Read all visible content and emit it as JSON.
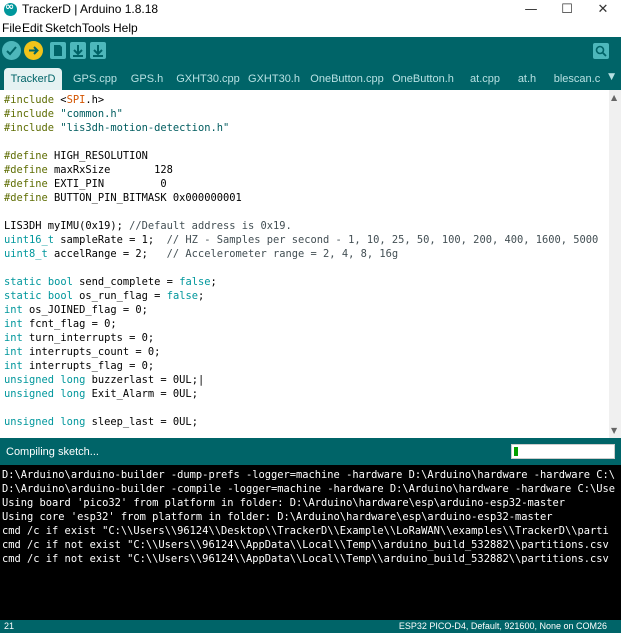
{
  "window": {
    "title": "TrackerD | Arduino 1.8.18",
    "minimize": "—",
    "maximize": "☐",
    "close": "✕"
  },
  "menu": [
    "File",
    "Edit",
    "Sketch",
    "Tools",
    "Help"
  ],
  "toolbar": {
    "buttons": [
      "verify-icon",
      "upload-icon",
      "new-icon",
      "open-icon",
      "save-icon"
    ],
    "serial_monitor": "serial-monitor-icon"
  },
  "tabs": [
    "TrackerD",
    "GPS.cpp",
    "GPS.h",
    "GXHT30.cpp",
    "GXHT30.h",
    "OneButton.cpp",
    "OneButton.h",
    "at.cpp",
    "at.h",
    "blescan.c"
  ],
  "active_tab": 0,
  "tab_menu": "▼",
  "code": [
    [
      {
        "t": "#include",
        "c": "pp"
      },
      {
        "t": " <",
        "c": ""
      },
      {
        "t": "SPI",
        "c": "inc"
      },
      {
        "t": ".h>",
        "c": ""
      }
    ],
    [
      {
        "t": "#include",
        "c": "pp"
      },
      {
        "t": " ",
        "c": ""
      },
      {
        "t": "\"common.h\"",
        "c": "str"
      }
    ],
    [
      {
        "t": "#include",
        "c": "pp"
      },
      {
        "t": " ",
        "c": ""
      },
      {
        "t": "\"lis3dh-motion-detection.h\"",
        "c": "str"
      }
    ],
    [
      {
        "t": "",
        "c": ""
      }
    ],
    [
      {
        "t": "#define",
        "c": "pp"
      },
      {
        "t": " HIGH_RESOLUTION",
        "c": ""
      }
    ],
    [
      {
        "t": "#define",
        "c": "pp"
      },
      {
        "t": " maxRxSize       128",
        "c": ""
      }
    ],
    [
      {
        "t": "#define",
        "c": "pp"
      },
      {
        "t": " EXTI_PIN         0",
        "c": ""
      }
    ],
    [
      {
        "t": "#define",
        "c": "pp"
      },
      {
        "t": " BUTTON_PIN_BITMASK 0x000000001",
        "c": ""
      }
    ],
    [
      {
        "t": "",
        "c": ""
      }
    ],
    [
      {
        "t": "LIS3DH myIMU(0x19); ",
        "c": ""
      },
      {
        "t": "//Default address is 0x19.",
        "c": "cm"
      }
    ],
    [
      {
        "t": "uint16_t",
        "c": "type"
      },
      {
        "t": " sampleRate = 1;  ",
        "c": ""
      },
      {
        "t": "// HZ - Samples per second - 1, 10, 25, 50, 100, 200, 400, 1600, 5000",
        "c": "cm"
      }
    ],
    [
      {
        "t": "uint8_t",
        "c": "type"
      },
      {
        "t": " accelRange = 2;   ",
        "c": ""
      },
      {
        "t": "// Accelerometer range = 2, 4, 8, 16g",
        "c": "cm"
      }
    ],
    [
      {
        "t": "",
        "c": ""
      }
    ],
    [
      {
        "t": "static",
        "c": "kw"
      },
      {
        "t": " ",
        "c": ""
      },
      {
        "t": "bool",
        "c": "type"
      },
      {
        "t": " send_complete = ",
        "c": ""
      },
      {
        "t": "false",
        "c": "kw"
      },
      {
        "t": ";",
        "c": ""
      }
    ],
    [
      {
        "t": "static",
        "c": "kw"
      },
      {
        "t": " ",
        "c": ""
      },
      {
        "t": "bool",
        "c": "type"
      },
      {
        "t": " os_run_flag = ",
        "c": ""
      },
      {
        "t": "false",
        "c": "kw"
      },
      {
        "t": ";",
        "c": ""
      }
    ],
    [
      {
        "t": "int",
        "c": "type"
      },
      {
        "t": " os_JOINED_flag = 0;",
        "c": ""
      }
    ],
    [
      {
        "t": "int",
        "c": "type"
      },
      {
        "t": " fcnt_flag = 0;",
        "c": ""
      }
    ],
    [
      {
        "t": "int",
        "c": "type"
      },
      {
        "t": " turn_interrupts = 0;",
        "c": ""
      }
    ],
    [
      {
        "t": "int",
        "c": "type"
      },
      {
        "t": " interrupts_count = 0;",
        "c": ""
      }
    ],
    [
      {
        "t": "int",
        "c": "type"
      },
      {
        "t": " interrupts_flag = 0;",
        "c": ""
      }
    ],
    [
      {
        "t": "unsigned",
        "c": "type"
      },
      {
        "t": " ",
        "c": ""
      },
      {
        "t": "long",
        "c": "type"
      },
      {
        "t": " buzzerlast = 0UL;|",
        "c": ""
      }
    ],
    [
      {
        "t": "unsigned",
        "c": "type"
      },
      {
        "t": " ",
        "c": ""
      },
      {
        "t": "long",
        "c": "type"
      },
      {
        "t": " Exit_Alarm = 0UL;",
        "c": ""
      }
    ],
    [
      {
        "t": "",
        "c": ""
      }
    ],
    [
      {
        "t": "unsigned",
        "c": "type"
      },
      {
        "t": " ",
        "c": ""
      },
      {
        "t": "long",
        "c": "type"
      },
      {
        "t": " sleep_last = 0UL;",
        "c": ""
      }
    ]
  ],
  "status": {
    "text": "Compiling sketch...",
    "progress": 0.04
  },
  "console": [
    "D:\\Arduino\\arduino-builder -dump-prefs -logger=machine -hardware D:\\Arduino\\hardware -hardware C:\\",
    "D:\\Arduino\\arduino-builder -compile -logger=machine -hardware D:\\Arduino\\hardware -hardware C:\\Use",
    "Using board 'pico32' from platform in folder: D:\\Arduino\\hardware\\esp\\arduino-esp32-master",
    "Using core 'esp32' from platform in folder: D:\\Arduino\\hardware\\esp\\arduino-esp32-master",
    "cmd /c if exist \"C:\\\\Users\\\\96124\\\\Desktop\\\\TrackerD\\\\Example\\\\LoRaWAN\\\\examples\\\\TrackerD\\\\parti",
    "cmd /c if not exist \"C:\\\\Users\\\\96124\\\\AppData\\\\Local\\\\Temp\\\\arduino_build_532882\\\\partitions.csv",
    "cmd /c if not exist \"C:\\\\Users\\\\96124\\\\AppData\\\\Local\\\\Temp\\\\arduino_build_532882\\\\partitions.csv"
  ],
  "footer": {
    "line": "21",
    "board": "ESP32 PICO-D4, Default, 921600, None on COM26"
  },
  "colors": {
    "teal": "#006468",
    "accent": "#00979c",
    "progress": "#05a000"
  }
}
